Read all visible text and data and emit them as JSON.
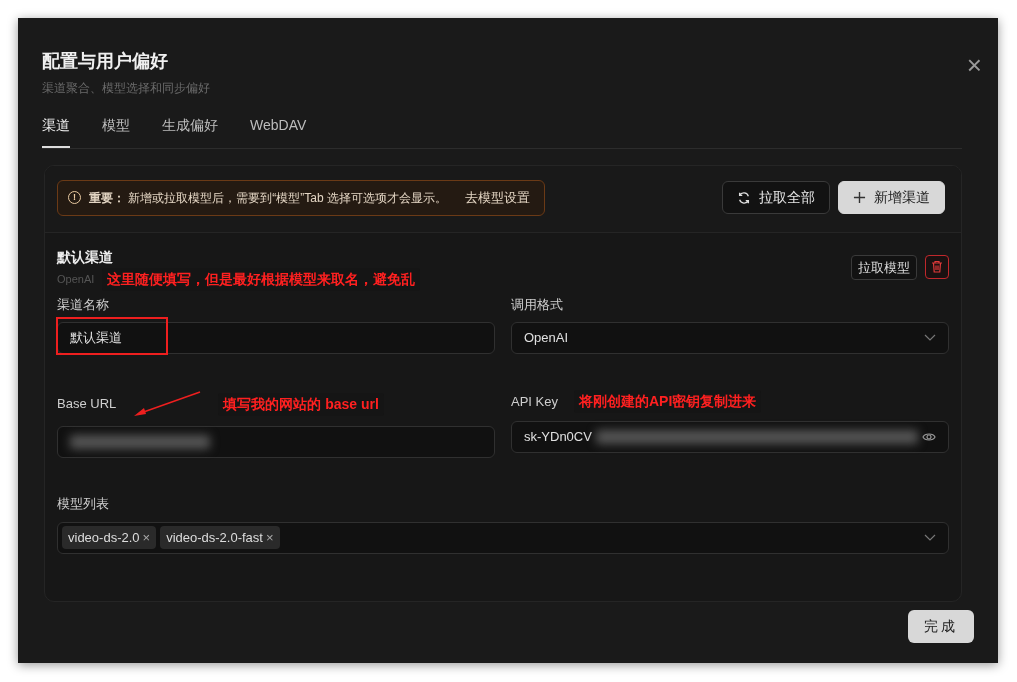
{
  "dialog": {
    "title": "配置与用户偏好",
    "subtitle": "渠道聚合、模型选择和同步偏好",
    "close": "×"
  },
  "tabs": [
    {
      "label": "渠道",
      "selected": true
    },
    {
      "label": "模型",
      "selected": false
    },
    {
      "label": "生成偏好",
      "selected": false
    },
    {
      "label": "WebDAV",
      "selected": false
    }
  ],
  "notice": {
    "icon": "!",
    "strong": "重要：",
    "text": "新增或拉取模型后，需要到“模型”Tab 选择可选项才会显示。",
    "link": "去模型设置"
  },
  "toolbar": [
    {
      "kind": "outline",
      "label": "拉取全部"
    },
    {
      "kind": "light",
      "label": "新增渠道"
    }
  ],
  "channel": {
    "title": "默认渠道",
    "subtitle": "OpenAI",
    "fetch_button": "拉取模型",
    "fields": [
      {
        "kind": "text",
        "label": "渠道名称",
        "value": "默认渠道"
      },
      {
        "kind": "select",
        "label": "调用格式",
        "value": "OpenAI"
      },
      {
        "kind": "blurred",
        "label": "Base URL"
      },
      {
        "kind": "secret",
        "label": "API Key",
        "value": "sk-YDn0CV"
      }
    ],
    "models_label": "模型列表",
    "models": [
      {
        "name": "video-ds-2.0",
        "remove": "×"
      },
      {
        "name": "video-ds-2.0-fast",
        "remove": "×"
      }
    ]
  },
  "annotations": [
    "这里随便填写，但是最好根据模型来取名，避免乱",
    "填写我的网站的 base url",
    "将刚创建的API密钥复制进来"
  ],
  "done_button": "完成"
}
